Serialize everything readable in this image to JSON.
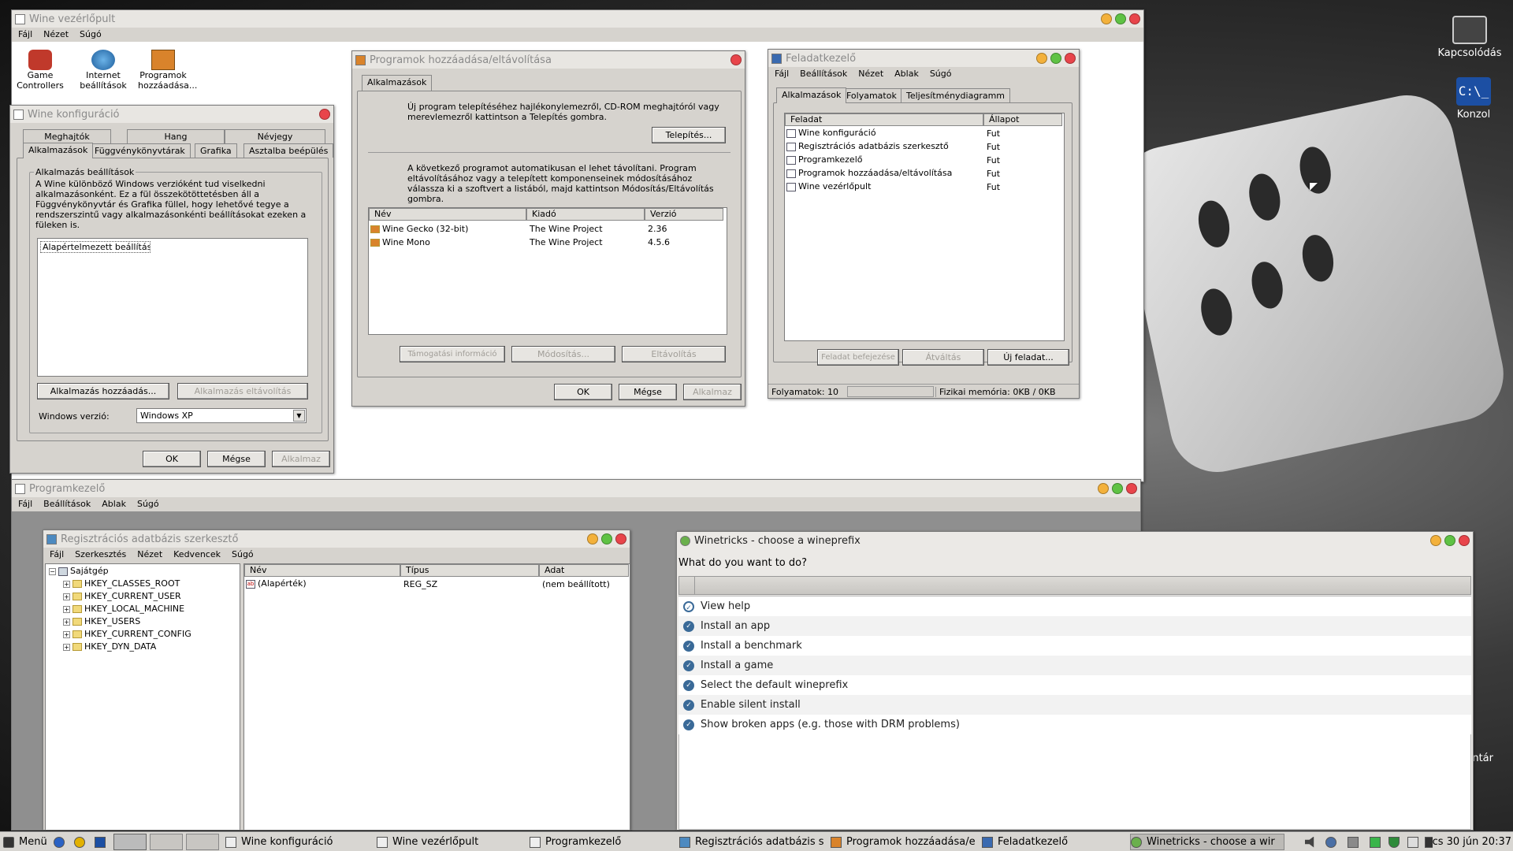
{
  "taskbar": {
    "menu": "Menü",
    "items": [
      "Wine konfiguráció",
      "Wine vezérlőpult",
      "Programkezelő",
      "Regisztrációs adatbázis s",
      "Programok hozzáadása/e",
      "Feladatkezelő",
      "Winetricks - choose a wir"
    ],
    "clock": "cs 30 jún 20:37"
  },
  "desktop": {
    "icons": [
      "Kapcsolódás",
      "Konzol"
    ],
    "partial_icon_label": "ntár"
  },
  "control_panel": {
    "title": "Wine vezérlőpult",
    "menu": [
      "Fájl",
      "Nézet",
      "Súgó"
    ],
    "icons": [
      {
        "l1": "Game",
        "l2": "Controllers",
        "icon": "gamepad-icon"
      },
      {
        "l1": "Internet",
        "l2": "beállítások",
        "icon": "globe-icon"
      },
      {
        "l1": "Programok",
        "l2": "hozzáadása...",
        "icon": "box-icon"
      }
    ]
  },
  "wine_config": {
    "title": "Wine konfiguráció",
    "tabs_row1": [
      "Meghajtók",
      "Hang",
      "Névjegy"
    ],
    "tabs_row2": [
      "Alkalmazások",
      "Függvénykönyvtárak",
      "Grafika",
      "Asztalba beépülés"
    ],
    "group_label": "Alkalmazás beállítások",
    "description": "A Wine különböző Windows verzióként tud viselkedni alkalmazásonként. Ez a fül összekötöttetésben áll a Függvénykönyvtár és Grafika füllel, hogy lehetővé tegye a rendszerszintű vagy alkalmazásonkénti beállításokat ezeken a füleken is.",
    "list_item": "Alapértelmezett beállítás",
    "add_button": "Alkalmazás hozzáadás...",
    "remove_button": "Alkalmazás eltávolítás",
    "windows_version_label": "Windows verzió:",
    "windows_version_value": "Windows XP",
    "ok": "OK",
    "cancel": "Mégse",
    "apply": "Alkalmaz"
  },
  "add_remove": {
    "title": "Programok hozzáadása/eltávolítása",
    "tab": "Alkalmazások",
    "install_text": "Új program telepítéséhez hajlékonylemezről, CD-ROM meghajtóról vagy merevlemezről kattintson a Telepítés gombra.",
    "install_button": "Telepítés...",
    "remove_text": "A következő programot automatikusan el lehet távolítani. Program eltávolításához vagy a telepített komponenseinek módosításához válassza ki a szoftvert a listából, majd kattintson Módosítás/Eltávolítás gombra.",
    "columns": [
      "Név",
      "Kiadó",
      "Verzió"
    ],
    "rows": [
      {
        "name": "Wine Gecko (32-bit)",
        "publisher": "The Wine Project",
        "version": "2.36"
      },
      {
        "name": "Wine Mono",
        "publisher": "The Wine Project",
        "version": "4.5.6"
      }
    ],
    "support_button": "Támogatási információ",
    "modify_button": "Módosítás...",
    "remove_button": "Eltávolítás",
    "ok": "OK",
    "cancel": "Mégse",
    "apply": "Alkalmaz"
  },
  "task_manager": {
    "title": "Feladatkezelő",
    "menu": [
      "Fájl",
      "Beállítások",
      "Nézet",
      "Ablak",
      "Súgó"
    ],
    "tabs": [
      "Alkalmazások",
      "Folyamatok",
      "Teljesítménydiagramm"
    ],
    "columns": [
      "Feladat",
      "Állapot"
    ],
    "rows": [
      {
        "task": "Wine konfiguráció",
        "status": "Fut"
      },
      {
        "task": "Regisztrációs adatbázis szerkesztő",
        "status": "Fut"
      },
      {
        "task": "Programkezelő",
        "status": "Fut"
      },
      {
        "task": "Programok hozzáadása/eltávolítása",
        "status": "Fut"
      },
      {
        "task": "Wine vezérlőpult",
        "status": "Fut"
      }
    ],
    "end_task": "Feladat befejezése",
    "switch_to": "Átváltás",
    "new_task": "Új feladat...",
    "status_processes": "Folyamatok: 10",
    "status_memory": "Fizikai memória: 0KB / 0KB"
  },
  "program_manager": {
    "title": "Programkezelő",
    "menu": [
      "Fájl",
      "Beállítások",
      "Ablak",
      "Súgó"
    ]
  },
  "regedit": {
    "title": "Regisztrációs adatbázis szerkesztő",
    "menu": [
      "Fájl",
      "Szerkesztés",
      "Nézet",
      "Kedvencek",
      "Súgó"
    ],
    "root": "Sajátgép",
    "keys": [
      "HKEY_CLASSES_ROOT",
      "HKEY_CURRENT_USER",
      "HKEY_LOCAL_MACHINE",
      "HKEY_USERS",
      "HKEY_CURRENT_CONFIG",
      "HKEY_DYN_DATA"
    ],
    "columns": [
      "Név",
      "Típus",
      "Adat"
    ],
    "value_row": {
      "name": "(Alapérték)",
      "type": "REG_SZ",
      "data": "(nem beállított)"
    }
  },
  "winetricks": {
    "title": "Winetricks - choose a wineprefix",
    "question": "What do you want to do?",
    "options": [
      "View help",
      "Install an app",
      "Install a benchmark",
      "Install a game",
      "Select the default wineprefix",
      "Enable silent install",
      "Show broken apps (e.g. those with DRM problems)"
    ]
  }
}
